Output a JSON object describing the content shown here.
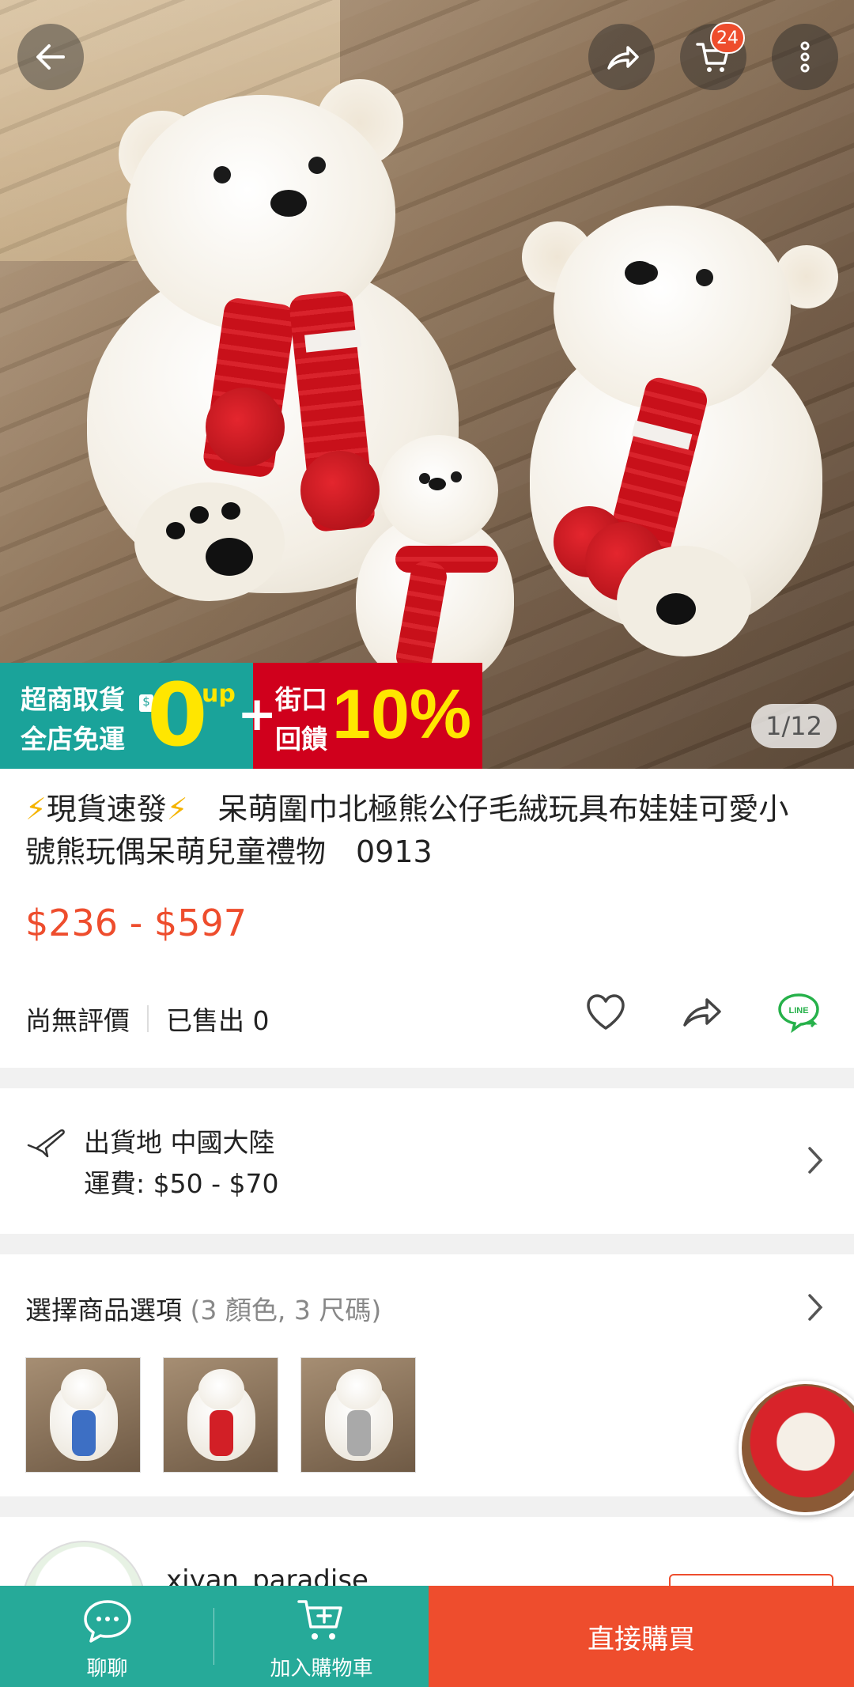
{
  "hero": {
    "image_counter": "1/12",
    "cart_count": "24",
    "promo": {
      "left_line1": "超商取貨",
      "left_line2": "全店免運",
      "left_currency": "$",
      "left_big": "0",
      "left_up": "up",
      "plus": "+",
      "right_line1": "街口",
      "right_line2": "回饋",
      "right_percent": "10%"
    }
  },
  "product": {
    "title_bolt": "⚡",
    "title_line1": "現貨速發",
    "title_rest": "呆萌圍巾北極熊公仔毛絨玩具布娃娃可愛小號熊玩偶呆萌兒童禮物　0913",
    "price": "$236 - $597",
    "rating_text": "尚無評價",
    "sold_text": "已售出 0"
  },
  "shipping": {
    "origin": "出貨地 中國大陸",
    "fee": "運費: $50 - $70"
  },
  "options": {
    "label": "選擇商品選項",
    "summary": "(3 顏色, 3 尺碼)",
    "swatches": [
      {
        "name": "blue",
        "color": "#3d6fc4"
      },
      {
        "name": "red",
        "color": "#d21f26"
      },
      {
        "name": "gray",
        "color": "#a9a9a9"
      }
    ]
  },
  "shop": {
    "name": "xiyan_paradise"
  },
  "bottom_bar": {
    "chat_label": "聊聊",
    "cart_label": "加入購物車",
    "buy_label": "直接購買"
  },
  "colors": {
    "accent": "#ee4d2d",
    "teal": "#26aa99",
    "promo_yellow": "#ffe600"
  }
}
